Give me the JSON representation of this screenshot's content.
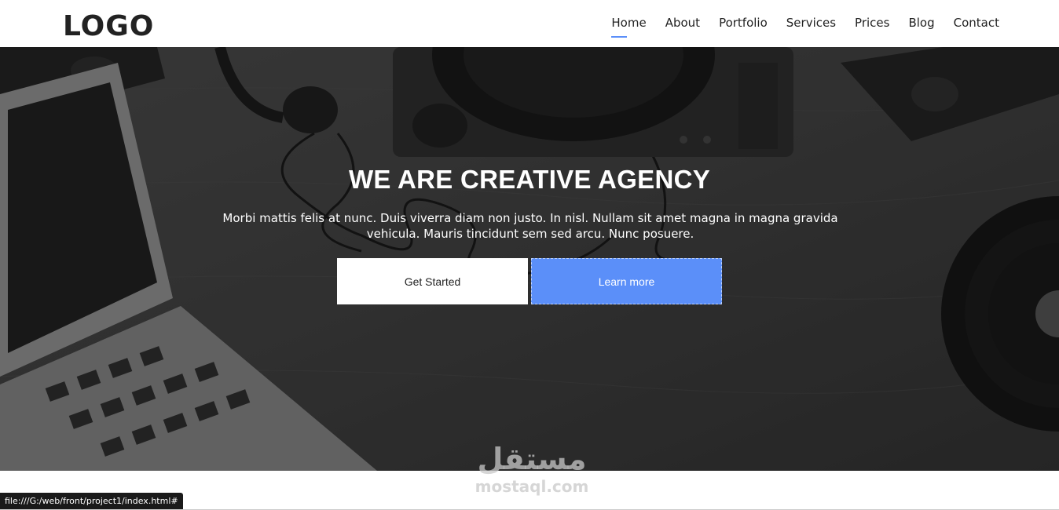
{
  "header": {
    "logo": "LOGO",
    "nav": [
      {
        "label": "Home",
        "active": true
      },
      {
        "label": "About",
        "active": false
      },
      {
        "label": "Portfolio",
        "active": false
      },
      {
        "label": "Services",
        "active": false
      },
      {
        "label": "Prices",
        "active": false
      },
      {
        "label": "Blog",
        "active": false
      },
      {
        "label": "Contact",
        "active": false
      }
    ]
  },
  "hero": {
    "title": "WE ARE CREATIVE AGENCY",
    "text": "Morbi mattis felis at nunc. Duis viverra diam non justo. In nisl. Nullam sit amet magna in magna gravida vehicula. Mauris tincidunt sem sed arcu. Nunc posuere.",
    "primary_button": "Get Started",
    "secondary_button": "Learn more"
  },
  "watermark": {
    "arabic": "مستقل",
    "latin": "mostaql.com"
  },
  "status_bar": {
    "url": "file:///G:/web/front/project1/index.html#"
  },
  "colors": {
    "accent": "#5b8ff9",
    "text_dark": "#222222",
    "hero_bg": "#3b3b3b"
  }
}
